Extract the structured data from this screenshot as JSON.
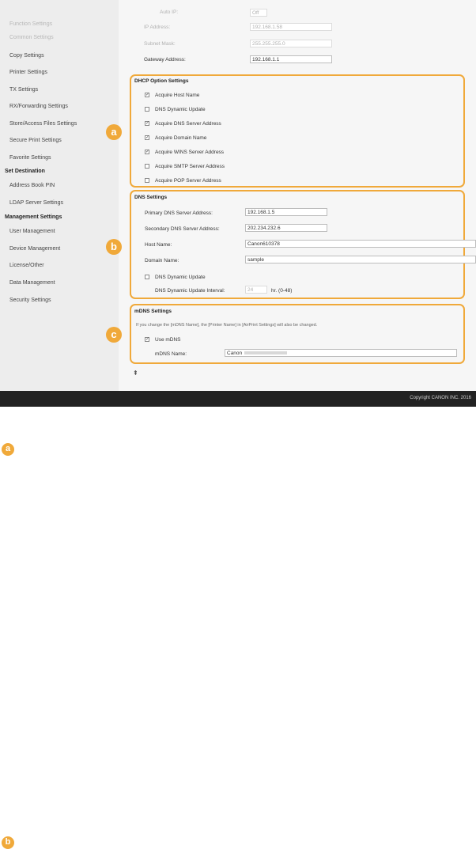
{
  "sidebar": {
    "items": [
      {
        "label": "Function Settings",
        "style": "faded"
      },
      {
        "label": "Common Settings",
        "style": "faded"
      },
      {
        "label": "Copy Settings",
        "style": "normal"
      },
      {
        "label": "Printer Settings",
        "style": "normal"
      },
      {
        "label": "TX Settings",
        "style": "normal"
      },
      {
        "label": "RX/Forwarding Settings",
        "style": "normal"
      },
      {
        "label": "Store/Access Files Settings",
        "style": "normal"
      },
      {
        "label": "Secure Print Settings",
        "style": "normal"
      },
      {
        "label": "Favorite Settings",
        "style": "normal"
      },
      {
        "label": "Set Destination",
        "style": "section"
      },
      {
        "label": "Address Book PIN",
        "style": "normal"
      },
      {
        "label": "LDAP Server Settings",
        "style": "normal"
      },
      {
        "label": "Management Settings",
        "style": "section"
      },
      {
        "label": "User Management",
        "style": "normal"
      },
      {
        "label": "Device Management",
        "style": "normal"
      },
      {
        "label": "License/Other",
        "style": "normal"
      },
      {
        "label": "Data Management",
        "style": "normal"
      },
      {
        "label": "Security Settings",
        "style": "normal"
      }
    ]
  },
  "ip": {
    "auto_ip_label": "Auto IP:",
    "auto_ip_value": "Off",
    "ip_address_label": "IP Address:",
    "ip_address_value": "192.168.1.58",
    "subnet_label": "Subnet Mask:",
    "subnet_value": "255.255.255.0",
    "gateway_label": "Gateway Address:",
    "gateway_value": "192.168.1.1"
  },
  "dhcp": {
    "title": "DHCP Option Settings",
    "options": [
      {
        "label": "Acquire Host Name",
        "checked": true
      },
      {
        "label": "DNS Dynamic Update",
        "checked": false
      },
      {
        "label": "Acquire DNS Server Address",
        "checked": true
      },
      {
        "label": "Acquire Domain Name",
        "checked": true
      },
      {
        "label": "Acquire WINS Server Address",
        "checked": true
      },
      {
        "label": "Acquire SMTP Server Address",
        "checked": false
      },
      {
        "label": "Acquire POP Server Address",
        "checked": false
      }
    ]
  },
  "dns": {
    "title": "DNS Settings",
    "primary_label": "Primary DNS Server Address:",
    "primary_value": "192.168.1.5",
    "secondary_label": "Secondary DNS Server Address:",
    "secondary_value": "202.234.232.6",
    "host_label": "Host Name:",
    "host_value": "Canon610378",
    "domain_label": "Domain Name:",
    "domain_value": "sample",
    "dynamic_update_label": "DNS Dynamic Update",
    "dynamic_update_checked": false,
    "interval_label": "DNS Dynamic Update Interval:",
    "interval_value": "24",
    "interval_unit": "hr. (0-48)"
  },
  "mdns": {
    "title": "mDNS Settings",
    "note": "If you change the [mDNS Name], the [Printer Name] in [AirPrint Settings] will also be changed.",
    "use_label": "Use mDNS",
    "use_checked": true,
    "name_label": "mDNS Name:",
    "name_value": "Canon"
  },
  "top_link": "⇞",
  "footer": {
    "copyright": "Copyright CANON INC. 2016"
  },
  "badges": {
    "a": "a",
    "b": "b",
    "c": "c"
  },
  "colors": {
    "accent": "#f0a93a",
    "sidebar_bg": "#ededed",
    "main_bg": "#f6f6f6",
    "footer_bg": "#222222"
  }
}
